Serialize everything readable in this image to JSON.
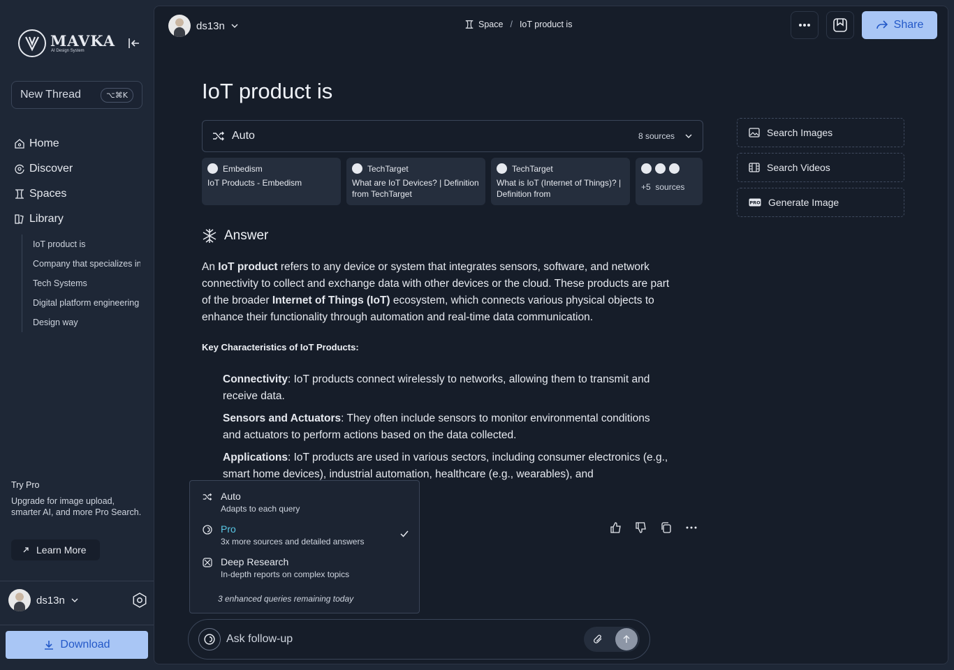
{
  "brand": {
    "name": "MAVKA",
    "tagline": "AI Design System"
  },
  "sidebar": {
    "new_thread": {
      "label": "New Thread",
      "shortcut": "⌥⌘K"
    },
    "nav": [
      {
        "label": "Home",
        "icon": "home-icon"
      },
      {
        "label": "Discover",
        "icon": "discover-icon"
      },
      {
        "label": "Spaces",
        "icon": "spaces-icon"
      },
      {
        "label": "Library",
        "icon": "library-icon"
      }
    ],
    "library_items": [
      "IoT product is",
      "Company that specializes in",
      "Tech Systems",
      "Digital platform engineering",
      "Design way"
    ],
    "try_pro": {
      "title": "Try Pro",
      "desc": "Upgrade for image upload, smarter AI, and more Pro Search.",
      "button": "Learn More"
    },
    "user": {
      "name": "ds13n"
    },
    "download": "Download"
  },
  "header": {
    "user": "ds13n",
    "breadcrumb": {
      "space": "Space",
      "sep": "/",
      "current": "IoT product is"
    },
    "share": "Share"
  },
  "thread": {
    "title": "IoT product is",
    "mode": {
      "label": "Auto",
      "sources": "8 sources"
    },
    "sources": [
      {
        "site": "Embedism",
        "title": "IoT Products - Embedism"
      },
      {
        "site": "TechTarget",
        "title": "What are IoT Devices? | Definition from TechTarget"
      },
      {
        "site": "TechTarget",
        "title": "What is IoT (Internet of Things)? | Definition from"
      }
    ],
    "more_sources": {
      "count": "+5",
      "label": "sources"
    },
    "answer_heading": "Answer",
    "answer": {
      "p1_a": "An ",
      "p1_b": "IoT product",
      "p1_c": " refers to any device or system that integrates sensors, software, and network connectivity to collect and exchange data with other devices or the cloud. These products are part of the broader ",
      "p1_d": "Internet of Things (IoT)",
      "p1_e": " ecosystem, which connects various physical objects to enhance their functionality through automation and real-time data communication."
    },
    "key_title": "Key Characteristics of IoT Products:",
    "bullets": [
      {
        "term": "Connectivity",
        "text": ": IoT products connect wirelessly to networks, allowing them to transmit and receive data."
      },
      {
        "term": "Sensors and Actuators",
        "text": ": They often include sensors to monitor environmental conditions and actuators to perform actions based on the data collected."
      },
      {
        "term": "Applications",
        "text": ": IoT products are used in various sectors, including consumer electronics (e.g., smart home devices), industrial automation, healthcare (e.g., wearables), and"
      }
    ]
  },
  "quick_actions": [
    "Search Images",
    "Search Videos",
    "Generate Image"
  ],
  "mode_dropdown": {
    "items": [
      {
        "label": "Auto",
        "desc": "Adapts to each query"
      },
      {
        "label": "Pro",
        "desc": "3x more sources and detailed answers"
      },
      {
        "label": "Deep Research",
        "desc": "In-depth reports on complex topics"
      }
    ],
    "footer": "3 enhanced queries remaining today"
  },
  "followup": {
    "placeholder": "Ask follow-up"
  },
  "colors": {
    "accent": "#a9c6f5",
    "accent_text": "#2358c8",
    "pro": "#5ac8e6",
    "bg": "#161d29",
    "sidebar_bg": "#1e2736"
  }
}
